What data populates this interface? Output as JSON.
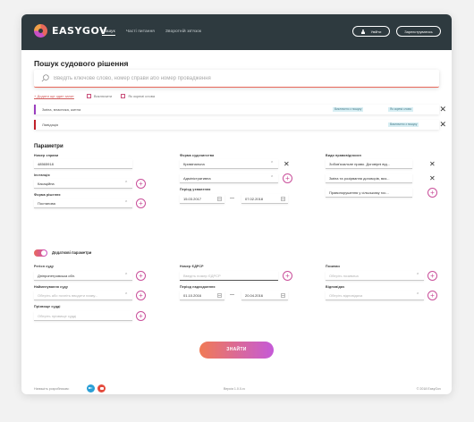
{
  "app": {
    "logo_text": "EASYGOV",
    "nav": [
      "Пошук",
      "Часті питання",
      "Зворотній зв'язок"
    ],
    "login_label": "Увійти",
    "register_label": "Зареєструватись"
  },
  "search": {
    "title": "Пошук судового рішення",
    "placeholder": "Введіть ключове слово, номер справи або номер провадження",
    "add_query_link": "+ Додати ще один запит",
    "exclude_label": "Виключити",
    "separate_words_label": "Як окремі слова"
  },
  "filters": [
    {
      "text": "Зміна, власника, житла",
      "tags": [
        "Виключено з пошуку",
        "Як окремі слова"
      ],
      "color": "#9b3fbf"
    },
    {
      "text": "Ліквідація",
      "tags": [
        "Виключено з пошуку"
      ],
      "color": "#c0202a"
    }
  ],
  "params": {
    "title": "Параметри",
    "case_number": {
      "label": "Номер справи",
      "value": "48565918"
    },
    "instance": {
      "label": "Інстанція",
      "value": "Касаційна"
    },
    "decision_form": {
      "label": "Форма рішення",
      "value": "Постанова"
    },
    "proceeding_form": {
      "label": "Форма судочинства",
      "values": [
        "Кримінальна",
        "Адміністративна"
      ]
    },
    "decision_period": {
      "label": "Період ухвалення",
      "from": "15.03.2017",
      "to": "07.02.2018"
    },
    "legal_types": {
      "label": "Види правовідносин",
      "values": [
        "Зобов'язальне право. Договірні від...",
        "Зміна та розірвання договорів, виз...",
        "Правопорушення у сільському гос..."
      ]
    }
  },
  "extra": {
    "toggle_label": "Додаткові параметри",
    "court_region": {
      "label": "Регіон суду",
      "value": "Дніпропетровська обл."
    },
    "court_name": {
      "label": "Найменування суду",
      "placeholder": "Оберіть або почніть вводити назву..."
    },
    "judge_name": {
      "label": "Прізвище судді",
      "placeholder": "Оберіть прізвище судді"
    },
    "edrpou": {
      "label": "Номер ЄДРСР",
      "placeholder": "Введіть номер ЄДРСР"
    },
    "receipt_period": {
      "label": "Період надходження",
      "from": "01.10.2016",
      "to": "20.04.2016"
    },
    "plaintiff": {
      "label": "Позивач",
      "placeholder": "Оберіть позивача"
    },
    "defendant": {
      "label": "Відповідач",
      "placeholder": "Оберіть відповідача"
    }
  },
  "submit_label": "ЗНАЙТИ",
  "footer": {
    "dev": "Напишіть розробникам:",
    "version": "Версія 1.0.0-rc",
    "copyright": "© 2018 EasyGov"
  }
}
